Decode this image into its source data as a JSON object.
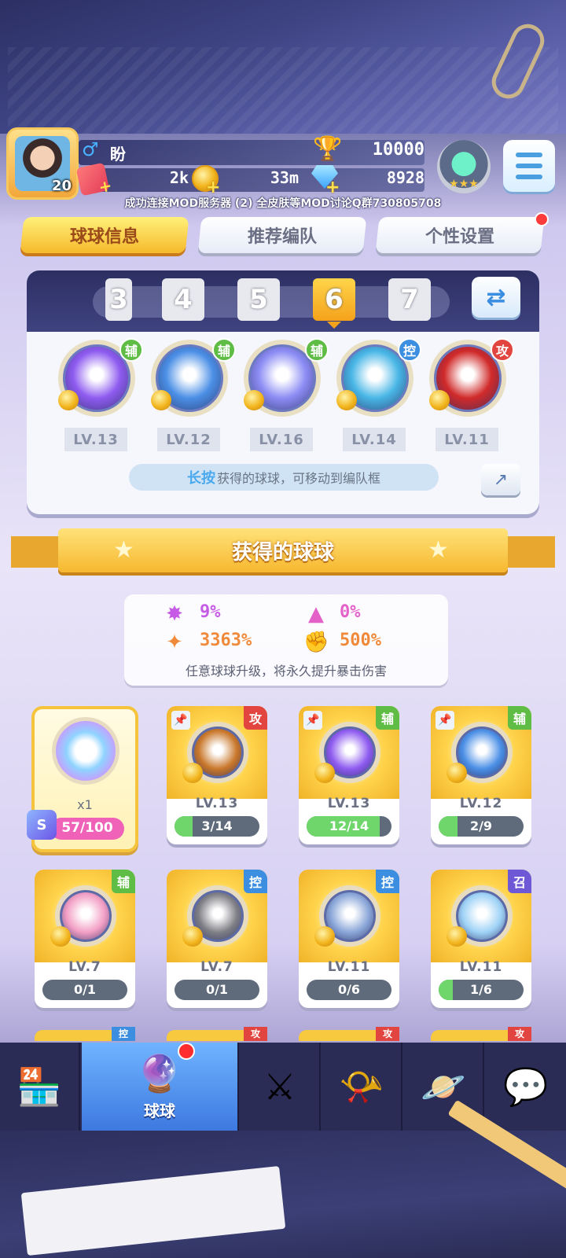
{
  "header": {
    "avatar_level": "20",
    "player_name": "盼",
    "gender_symbol": "♂",
    "trophies": "10000",
    "stamina": "2k",
    "coins": "33m",
    "gems": "8928",
    "notice": "成功连接MOD服务器 (2) 全皮肤等MOD讨论Q群730805708"
  },
  "tabs": [
    {
      "label": "球球信息",
      "active": true
    },
    {
      "label": "推荐编队",
      "active": false
    },
    {
      "label": "个性设置",
      "active": false
    }
  ],
  "team": {
    "slots": [
      "3",
      "4",
      "5",
      "6",
      "7"
    ],
    "active_slot": "6",
    "members": [
      {
        "tag": "辅",
        "level": "LV.13",
        "tag_color": "#5fbd46",
        "orb_color": "#8e5bf0"
      },
      {
        "tag": "辅",
        "level": "LV.12",
        "tag_color": "#5fbd46",
        "orb_color": "#4b8fe6"
      },
      {
        "tag": "辅",
        "level": "LV.16",
        "tag_color": "#5fbd46",
        "orb_color": "#8c8cf5"
      },
      {
        "tag": "控",
        "level": "LV.14",
        "tag_color": "#3c8ee0",
        "orb_color": "#48b6e6"
      },
      {
        "tag": "攻",
        "level": "LV.11",
        "tag_color": "#e2453f",
        "orb_color": "#d12a2a"
      }
    ],
    "hint_strong": "长按",
    "hint_text": "获得的球球，可移动到编队框"
  },
  "section_title": "获得的球球",
  "stats": {
    "items": [
      {
        "icon": "purple-burst-icon",
        "value": "9%",
        "color": "#c65ce6"
      },
      {
        "icon": "pink-arrow-icon",
        "value": "0%",
        "color": "#e461c8"
      },
      {
        "icon": "orange-crit-icon",
        "value": "3363%",
        "color": "#f08a3a"
      },
      {
        "icon": "red-fist-icon",
        "value": "500%",
        "color": "#e0533a"
      }
    ],
    "caption": "任意球球升级，将永久提升暴击伤害"
  },
  "special_card": {
    "count": "x1",
    "progress_text": "57/100",
    "progress": 0.57
  },
  "cards": [
    {
      "tag": "攻",
      "tag_color": "#e2453f",
      "level": "LV.13",
      "progress_text": "3/14",
      "progress": 0.21,
      "pinned": true,
      "orb_color": "#c9772a"
    },
    {
      "tag": "辅",
      "tag_color": "#5fbd46",
      "level": "LV.13",
      "progress_text": "12/14",
      "progress": 0.86,
      "pinned": true,
      "orb_color": "#8e5bf0"
    },
    {
      "tag": "辅",
      "tag_color": "#5fbd46",
      "level": "LV.12",
      "progress_text": "2/9",
      "progress": 0.22,
      "pinned": true,
      "orb_color": "#4b8fe6"
    },
    {
      "tag": "辅",
      "tag_color": "#5fbd46",
      "level": "LV.7",
      "progress_text": "0/1",
      "progress": 0,
      "pinned": false,
      "orb_color": "#f29ec4"
    },
    {
      "tag": "控",
      "tag_color": "#3c8ee0",
      "level": "LV.7",
      "progress_text": "0/1",
      "progress": 0,
      "pinned": false,
      "orb_color": "#7f7f86"
    },
    {
      "tag": "控",
      "tag_color": "#3c8ee0",
      "level": "LV.11",
      "progress_text": "0/6",
      "progress": 0,
      "pinned": false,
      "orb_color": "#8aa6d8"
    },
    {
      "tag": "召",
      "tag_color": "#6e58d6",
      "level": "LV.11",
      "progress_text": "1/6",
      "progress": 0.17,
      "pinned": false,
      "orb_color": "#9ed2f6"
    }
  ],
  "peek_tags": [
    "控",
    "攻",
    "攻",
    "攻"
  ],
  "nav": {
    "items": [
      {
        "name": "shop",
        "icon": "shop-icon"
      },
      {
        "name": "balls",
        "icon": "ball-icon",
        "label": "球球",
        "active": true
      },
      {
        "name": "battle",
        "icon": "crossed-swords-icon"
      },
      {
        "name": "whistle",
        "icon": "whistle-icon"
      },
      {
        "name": "planet",
        "icon": "planet-icon"
      },
      {
        "name": "social",
        "icon": "chat-heart-icon"
      }
    ]
  }
}
